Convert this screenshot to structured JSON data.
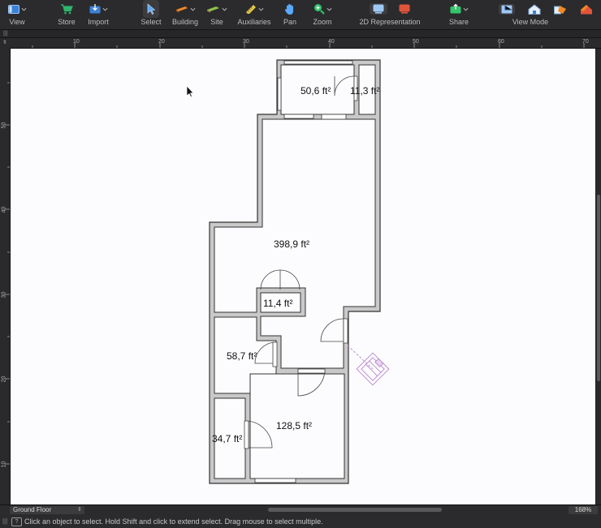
{
  "toolbar": {
    "items": [
      {
        "label": "View"
      },
      {
        "label": "Store"
      },
      {
        "label": "Import"
      },
      {
        "label": "Select"
      },
      {
        "label": "Building"
      },
      {
        "label": "Site"
      },
      {
        "label": "Auxiliaries"
      },
      {
        "label": "Pan"
      },
      {
        "label": "Zoom"
      },
      {
        "label": "2D Representation"
      },
      {
        "label": "Share"
      },
      {
        "label": "View Mode"
      }
    ],
    "colors": {
      "store": "#2fb56b",
      "select": "#5aa9ff",
      "building": "#f08a24",
      "pan": "#5aa9ff",
      "zoom": "#34c46b",
      "representation_3d": "#e0553a"
    }
  },
  "ruler": {
    "unit": "ft",
    "top_ticks": [
      "10",
      "20",
      "30",
      "40",
      "50",
      "60",
      "70"
    ],
    "left_ticks": [
      "50",
      "40",
      "30",
      "20",
      "10"
    ]
  },
  "plan": {
    "rooms": [
      {
        "area": "50,6 ft²"
      },
      {
        "area": "11,3 ft²"
      },
      {
        "area": "398,9 ft²"
      },
      {
        "area": "11,4 ft²"
      },
      {
        "area": "58,7 ft²"
      },
      {
        "area": "128,5 ft²"
      },
      {
        "area": "34,7 ft²"
      }
    ]
  },
  "bottom": {
    "floor": "Ground Floor",
    "zoom": "168%"
  },
  "status": {
    "message": "Click an object to select. Hold Shift and click to extend select. Drag mouse to select multiple."
  }
}
